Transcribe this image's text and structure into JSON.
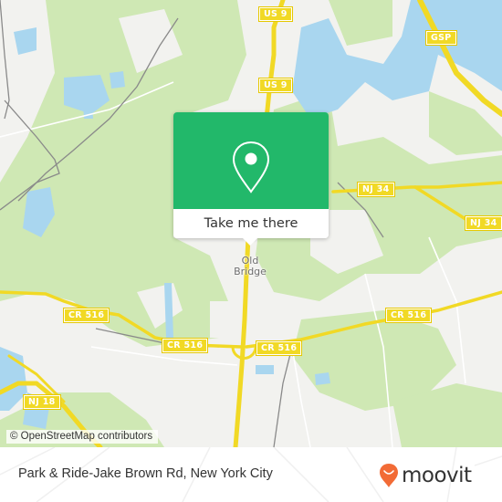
{
  "map": {
    "colors": {
      "land": "#f2f2ef",
      "forest": "#cfe8b4",
      "water": "#a9d6ef",
      "highway": "#f1d925",
      "rail": "#8a8a8a",
      "popup": "#22b86a",
      "moovit_orange": "#f26b36"
    },
    "road_labels": [
      {
        "id": "us9-north",
        "text": "US 9"
      },
      {
        "id": "us9-south",
        "text": "US 9"
      },
      {
        "id": "gsp",
        "text": "GSP"
      },
      {
        "id": "nj34-west",
        "text": "NJ 34"
      },
      {
        "id": "nj34-east",
        "text": "NJ 34"
      },
      {
        "id": "cr516-west",
        "text": "CR 516"
      },
      {
        "id": "cr516-center",
        "text": "CR 516"
      },
      {
        "id": "cr516-mid",
        "text": "CR 516"
      },
      {
        "id": "cr516-east",
        "text": "CR 516"
      },
      {
        "id": "nj18",
        "text": "NJ 18"
      }
    ],
    "place_label": {
      "line1": "Old",
      "line2": "Bridge"
    },
    "attribution": "© OpenStreetMap contributors"
  },
  "popup": {
    "icon": "map-pin-icon",
    "button_label": "Take me there"
  },
  "footer": {
    "title": "Park & Ride-Jake Brown Rd, New York City",
    "logo_text": "moovit",
    "logo_icon": "moovit-smile-pin-icon"
  }
}
